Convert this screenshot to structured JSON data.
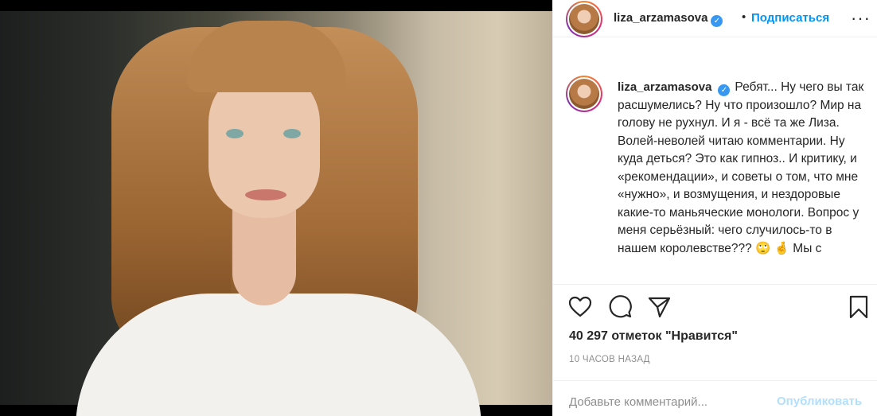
{
  "post": {
    "username": "liza_arzamasova",
    "verified_glyph": "✓",
    "follow_label": "Подписаться",
    "dot": "•",
    "more_glyph": "···"
  },
  "caption": {
    "username": "liza_arzamasova",
    "text": "Ребят... Ну чего вы так расшумелись? Ну что произошло? Мир на голову не рухнул. И я - всё та же Лиза. Волей-неволей читаю комментарии. Ну куда деться? Это как гипноз.. И критику, и «рекомендации», и советы о том, что мне «нужно», и возмущения, и нездоровые какие-то маньяческие монологи. Вопрос у меня серьёзный: чего случилось-то в нашем королевстве??? 🙄 🤞 Мы с"
  },
  "stats": {
    "likes": "40 297 отметок \"Нравится\"",
    "time": "10 ЧАСОВ НАЗАД"
  },
  "comment": {
    "placeholder": "Добавьте комментарий...",
    "publish_label": "Опубликовать"
  },
  "icons": {
    "like": "heart-icon",
    "comment": "comment-icon",
    "share": "share-icon",
    "save": "bookmark-icon"
  },
  "colors": {
    "link_blue": "#0095f6",
    "publish_disabled": "#b2dffc",
    "verified_blue": "#3897f0",
    "muted": "#8e8e8e"
  }
}
